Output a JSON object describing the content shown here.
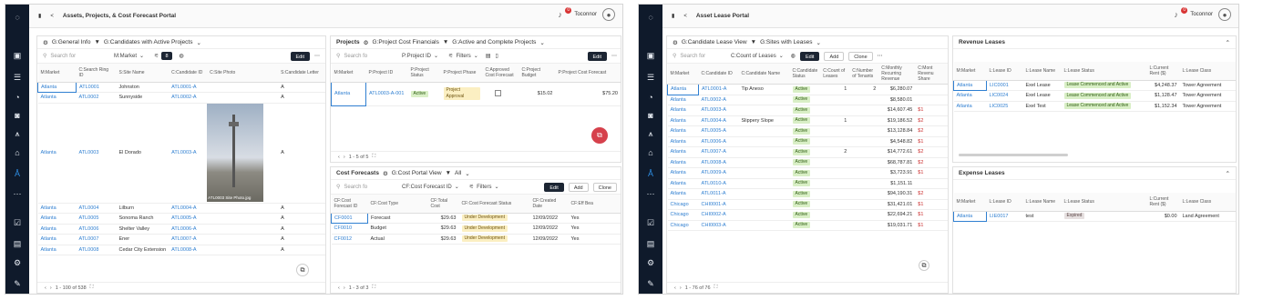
{
  "left": {
    "app_title": "Assets, Projects, & Cost Forecast Portal",
    "user": "Toconnor",
    "badge": "0",
    "sites": {
      "view": "G:General Info",
      "filter": "G:Candidates with Active Projects",
      "search_placeholder": "Search for",
      "field": "M:Market",
      "filter_count": "8",
      "edit": "Edit",
      "columns": [
        "M:Market",
        "C:Search Ring ID",
        "S:Site Name",
        "C:Candidate ID",
        "C:Site Photo",
        "S:Candidate Letter"
      ],
      "rows": [
        [
          "Atlanta",
          "ATL0001",
          "Johnston",
          "ATL0001-A",
          "",
          "A"
        ],
        [
          "Atlanta",
          "ATL0002",
          "Sunnyside",
          "ATL0002-A",
          "",
          "A"
        ],
        [
          "Atlanta",
          "ATL0003",
          "El Dorado",
          "ATL0003-A",
          "",
          "A"
        ],
        [
          "Atlanta",
          "ATL0004",
          "Lilburn",
          "ATL0004-A",
          "",
          "A"
        ],
        [
          "Atlanta",
          "ATL0005",
          "Sonoma Ranch",
          "ATL0005-A",
          "",
          "A"
        ],
        [
          "Atlanta",
          "ATL0006",
          "Shelter Valley",
          "ATL0006-A",
          "",
          "A"
        ],
        [
          "Atlanta",
          "ATL0007",
          "Ener",
          "ATL0007-A",
          "",
          "A"
        ],
        [
          "Atlanta",
          "ATL0008",
          "Cedar City Extension",
          "ATL0008-A",
          "",
          "A"
        ]
      ],
      "photo_caption": "ATL0003 Site Photo.jpg",
      "footer": "1 - 100 of 538"
    },
    "projects": {
      "title": "Projects",
      "view": "G:Project Cost Financials",
      "filter": "G:Active and Complete Projects",
      "search_placeholder": "Search fo",
      "field": "P:Project ID",
      "filter_label": "Filters",
      "edit": "Edit",
      "columns": [
        "M:Market",
        "P:Project ID",
        "P:Project Status",
        "P:Project Phase",
        "C:Approved Cost Forecast",
        "C:Project Budget",
        "P:Project Cost Forecast"
      ],
      "rows": [
        [
          "Atlanta",
          "ATL0003-A-001",
          "Active",
          "Project Approval",
          "",
          "$15.02",
          "$75.20"
        ]
      ],
      "footer": "1 - 5 of 5"
    },
    "forecasts": {
      "title": "Cost Forecasts",
      "view": "G:Cost Portal View",
      "filter": "All",
      "search_placeholder": "Search fo",
      "field": "CF:Cost Forecast ID",
      "filter_label": "Filters",
      "edit": "Edit",
      "add": "Add",
      "clone": "Clone",
      "columns": [
        "CF:Cost Forecast ID",
        "CF:Cost Type",
        "CF:Total Cost",
        "CF:Cost Forecast Status",
        "CF:Created Date",
        "CF:Eff Bea"
      ],
      "rows": [
        [
          "CF0001",
          "Forecast",
          "$29.63",
          "Under Development",
          "12/09/2022",
          "Yes"
        ],
        [
          "CF0010",
          "Budget",
          "$29.63",
          "Under Development",
          "12/09/2022",
          "Yes"
        ],
        [
          "CF0012",
          "Actual",
          "$29.63",
          "Under Development",
          "12/09/2022",
          "Yes"
        ]
      ],
      "footer": "1 - 3 of 3"
    }
  },
  "right": {
    "app_title": "Asset Lease Portal",
    "user": "Toconnor",
    "badge": "0",
    "leases": {
      "view": "G:Candidate Lease View",
      "filter": "G:Sites with Leases",
      "search_placeholder": "Search for",
      "field": "C:Count of Leases",
      "edit": "Edit",
      "add": "Add",
      "clone": "Clone",
      "columns": [
        "M:Market",
        "C:Candidate ID",
        "C:Candidate Name",
        "C:Candidate Status",
        "C:Count of Leases",
        "C:Number of Tenants",
        "C:Monthly Recurring Revenue",
        "C:Mont Revenu Share"
      ],
      "rows": [
        [
          "Atlanta",
          "ATL0001-A",
          "Tip Aneso",
          "Active",
          "1",
          "2",
          "$6,280.07",
          ""
        ],
        [
          "Atlanta",
          "ATL0002-A",
          "",
          "Active",
          "",
          "",
          "$8,580.01",
          ""
        ],
        [
          "Atlanta",
          "ATL0003-A",
          "",
          "Active",
          "",
          "",
          "$14,607.45",
          "$1"
        ],
        [
          "Atlanta",
          "ATL0004-A",
          "Slippery Slope",
          "Active",
          "1",
          "",
          "$19,186.52",
          "$2"
        ],
        [
          "Atlanta",
          "ATL0005-A",
          "",
          "Active",
          "",
          "",
          "$13,128.84",
          "$2"
        ],
        [
          "Atlanta",
          "ATL0006-A",
          "",
          "Active",
          "",
          "",
          "$4,548.82",
          "$1"
        ],
        [
          "Atlanta",
          "ATL0007-A",
          "",
          "Active",
          "2",
          "",
          "$14,772.61",
          "$2"
        ],
        [
          "Atlanta",
          "ATL0008-A",
          "",
          "Active",
          "",
          "",
          "$68,787.81",
          "$2"
        ],
        [
          "Atlanta",
          "ATL0009-A",
          "",
          "Active",
          "",
          "",
          "$3,723.91",
          "$1"
        ],
        [
          "Atlanta",
          "ATL0010-A",
          "",
          "Active",
          "",
          "",
          "$1,151.11",
          ""
        ],
        [
          "Atlanta",
          "ATL0011-A",
          "",
          "Active",
          "",
          "",
          "$94,190.31",
          "$2"
        ],
        [
          "Chicago",
          "CHI0001-A",
          "",
          "Active",
          "",
          "",
          "$31,421.01",
          "$1"
        ],
        [
          "Chicago",
          "CHI0002-A",
          "",
          "Active",
          "",
          "",
          "$22,694.21",
          "$1"
        ],
        [
          "Chicago",
          "CHI0003-A",
          "",
          "Active",
          "",
          "",
          "$19,031.71",
          "$1"
        ]
      ],
      "footer": "1 - 76 of 76"
    },
    "revenue": {
      "title": "Revenue Leases",
      "columns": [
        "M:Market",
        "L:Lease ID",
        "L:Lease Name",
        "L:Lease Status",
        "L:Current Rent ($)",
        "L:Lease Class"
      ],
      "rows": [
        [
          "Atlanta",
          "LIC0001",
          "Exel Lease",
          "Lease Commenced and Active",
          "$4,248.37",
          "Tower Agreement"
        ],
        [
          "Atlanta",
          "LIC0024",
          "Exel Lease",
          "Lease Commenced and Active",
          "$1,128.47",
          "Tower Agreement"
        ],
        [
          "Atlanta",
          "LIC0025",
          "Exel Test",
          "Lease Commenced and Active",
          "$1,152.34",
          "Tower Agreement"
        ]
      ]
    },
    "expense": {
      "title": "Expense Leases",
      "columns": [
        "M:Market",
        "L:Lease ID",
        "L:Lease Name",
        "L:Lease Status",
        "L:Current Rent ($)",
        "L:Lease Class"
      ],
      "rows": [
        [
          "Atlanta",
          "LIE0017",
          "test",
          "Expired",
          "$0.00",
          "Land Agreement"
        ]
      ]
    }
  }
}
